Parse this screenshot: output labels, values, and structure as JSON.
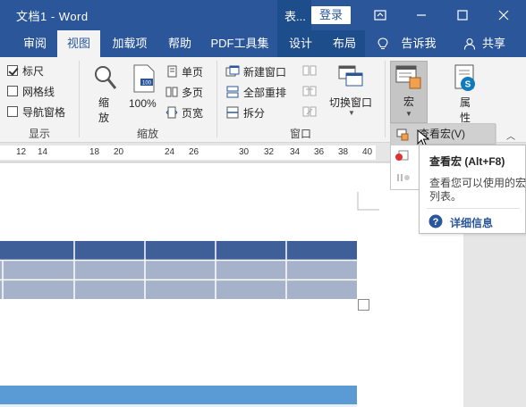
{
  "titlebar": {
    "title": "文档1  -  Word",
    "table_context": "表...",
    "login": "登录"
  },
  "tabs": [
    {
      "label": "审阅"
    },
    {
      "label": "视图"
    },
    {
      "label": "加载项"
    },
    {
      "label": "帮助"
    },
    {
      "label": "PDF工具集"
    },
    {
      "label": "设计"
    },
    {
      "label": "布局"
    },
    {
      "label": "告诉我"
    },
    {
      "label": "共享"
    }
  ],
  "ribbon": {
    "show": {
      "ruler": "标尺",
      "gridlines": "网格线",
      "nav_pane": "导航窗格",
      "label": "显示"
    },
    "zoom": {
      "zoom_label_1": "缩",
      "zoom_label_2": "放",
      "percent": "100%",
      "single_page": "单页",
      "multi_page": "多页",
      "page_width": "页宽",
      "label": "缩放"
    },
    "window": {
      "new_window": "新建窗口",
      "arrange_all": "全部重排",
      "split": "拆分",
      "switch_window": "切换窗口",
      "label": "窗口"
    },
    "macro": {
      "label": "宏"
    },
    "properties": {
      "label_1": "属",
      "label_2": "性"
    }
  },
  "ruler": {
    "numbers": [
      "12",
      "14",
      "18",
      "20",
      "24",
      "26",
      "30",
      "32",
      "34",
      "36",
      "38",
      "40"
    ]
  },
  "menu": {
    "view_macro": "查看宏(V)"
  },
  "tooltip": {
    "title": "查看宏 (Alt+F8)",
    "desc_line1": "查看您可以使用的宏",
    "desc_line2": "列表。",
    "more_info": "详细信息"
  },
  "colors": {
    "brand": "#2b579a",
    "table_header": "#3e5f98",
    "table_body": "#a6b2c9",
    "table2_header": "#5b9bd5"
  }
}
